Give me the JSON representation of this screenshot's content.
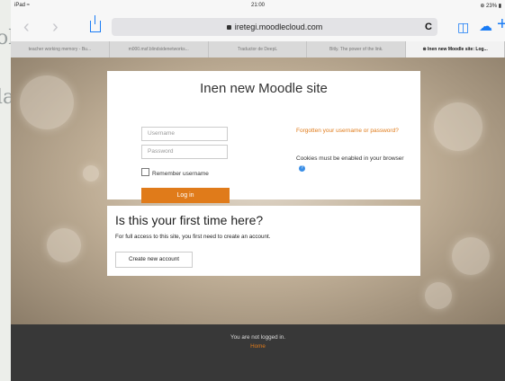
{
  "status_bar": {
    "device": "iPad ≈",
    "time": "21:00",
    "battery": "⊕ 23% ▮"
  },
  "browser": {
    "url": "iretegi.moodlecloud.com",
    "reload_glyph": "C",
    "back_glyph": "‹",
    "forward_glyph": "›",
    "tabs": [
      {
        "label": "teacher working memory - Bu..."
      },
      {
        "label": "m000.msf.blindsidenetworks..."
      },
      {
        "label": "Traductor de DeepL"
      },
      {
        "label": "Bitly. The power of the link."
      },
      {
        "label": "Inen new Moodle site: Log..."
      }
    ]
  },
  "login": {
    "title": "Inen new Moodle site",
    "username_placeholder": "Username",
    "password_placeholder": "Password",
    "remember_label": "Remember username",
    "login_button": "Log in",
    "forgot_link": "Forgotten your username or password?",
    "cookies_text": "Cookies must be enabled in your browser",
    "help_glyph": "?"
  },
  "first_time": {
    "title": "Is this your first time here?",
    "text": "For full access to this site, you first need to create an account.",
    "create_button": "Create new account"
  },
  "footer": {
    "not_logged_in": "You are not logged in.",
    "home_link": "Home"
  },
  "left_fragment": {
    "top": "ol",
    "bottom": "la"
  },
  "colors": {
    "accent": "#e07b1a",
    "ios_blue": "#1a7cf5",
    "footer_bg": "#383838"
  }
}
